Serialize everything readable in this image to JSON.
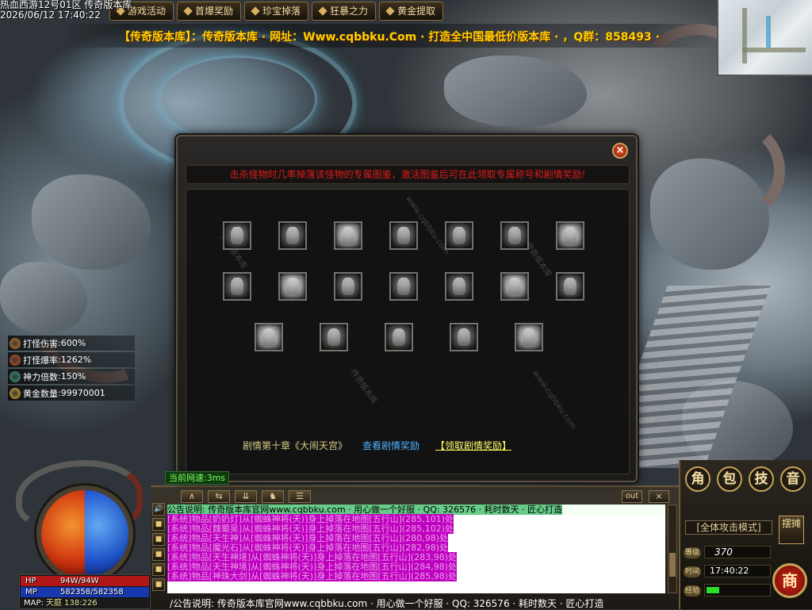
{
  "window": {
    "title": "热血西游12号01区 传奇版本库",
    "timestamp": "2026/06/12 17:40:22"
  },
  "top_menu": [
    {
      "label": "游戏活动"
    },
    {
      "label": "首爆奖励"
    },
    {
      "label": "珍宝掉落"
    },
    {
      "label": "狂暴之力"
    },
    {
      "label": "黄金提取"
    }
  ],
  "marquee": "【传奇版本库】：传奇版本库 · 网址：Www.cqbbku.Com · 打造全中国最低价版本库 · ，Q群：858493 ·",
  "stats": [
    {
      "label": "打怪伤害",
      "value": "600%",
      "icon_color": "#c8781e"
    },
    {
      "label": "打怪爆率",
      "value": "1262%",
      "icon_color": "#d04a1a"
    },
    {
      "label": "神力倍数",
      "value": "150%",
      "icon_color": "#3a9a7a"
    },
    {
      "label": "黄金数量",
      "value": "99970001",
      "icon_color": "#e0b030"
    }
  ],
  "dialog": {
    "hint": "击杀怪物时几率掉落该怪物的专属图鉴，激活图鉴后可在此领取专属称号和剧情奖励!",
    "close_icon": "close-icon",
    "row_counts": [
      7,
      7,
      5
    ],
    "chapter_title": "剧情第十章《大闹天宫》",
    "view_reward": "查看剧情奖励",
    "claim_reward": "【领取剧情奖励】",
    "watermark": "www.cqbbku.com",
    "watermark_cn": "传奇版本库"
  },
  "ping": "当前网速:3ms",
  "toolbar": {
    "buttons": [
      "∧",
      "⇆",
      "⇊",
      "♞",
      "☰"
    ],
    "out_label": "out",
    "close_label": "×"
  },
  "side_icons": [
    "🔊",
    "■",
    "■",
    "■",
    "■",
    "■"
  ],
  "chat": {
    "header": "公告说明: 传奇版本库官网www.cqbbku.com · 用心做一个好服 · QQ: 326576 · 耗时数天 · 匠心打造",
    "lines": [
      "[系统]物品[奶奶灯]从[蜘蛛神将(天)]身上掉落在地图[五行山](285,101)处",
      "[系统]物品[魏蜀吴]从[蜘蛛神将(天)]身上掉落在地图[五行山](285,102)处",
      "[系统]物品[天生神]从[蜘蛛神将(天)]身上掉落在地图[五行山](280,98)处",
      "[系统]物品[魔光石]从[蜘蛛神将(天)]身上掉落在地图[五行山](282,98)处",
      "[系统]物品[天生神境]从[蜘蛛神将(天)]身上掉落在地图[五行山](283,98)处",
      "[系统]物品[天生神境]从[蜘蛛神将(天)]身上掉落在地图[五行山](284,98)处",
      "[系统]物品[神珠大剑]从[蜘蛛神将(天)]身上掉落在地图[五行山](285,98)处"
    ],
    "announce": "/公告说明: 传奇版本库官网www.cqbbku.com · 用心做一个好服 · QQ: 326576 · 耗时数天 · 匠心打造"
  },
  "status": {
    "hp_label": "HP",
    "hp_value": "94W/94W",
    "hp_fraction": 1.0,
    "mp_label": "MP",
    "mp_value": "582358/582358",
    "mp_fraction": 1.0,
    "map_label": "MAP:",
    "map_value": "天庭 138:226"
  },
  "right_panel": {
    "round_buttons": [
      "角",
      "包",
      "技",
      "音"
    ],
    "attack_mode": "[全体攻击模式]",
    "dual_button": "摆摊",
    "level_label": "等级",
    "level_value": "370",
    "time_label": "时间",
    "time_value": "17:40:22",
    "exp_label": "经验",
    "exp_fraction": 0.2,
    "shop_label": "商"
  }
}
